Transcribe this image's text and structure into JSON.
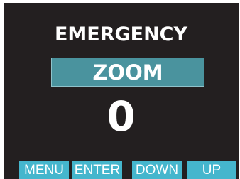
{
  "screen": {
    "title": "EMERGENCY",
    "mode_label": "ZOOM",
    "value": "0"
  },
  "softkeys": {
    "menu": "MENU",
    "enter": "ENTER",
    "down": "DOWN",
    "up": "UP"
  },
  "colors": {
    "display_background": "#231f20",
    "mode_box": "#4a939e",
    "softkey": "#45b6cd",
    "text": "#ffffff"
  }
}
